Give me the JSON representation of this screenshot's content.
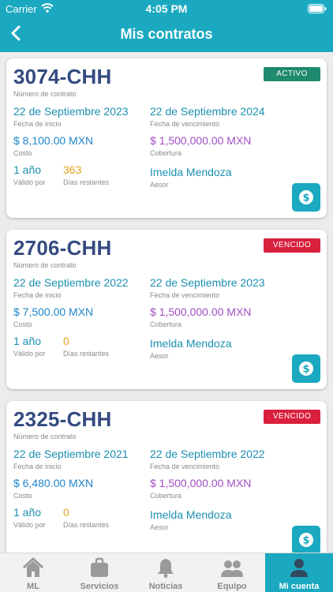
{
  "status_bar": {
    "carrier": "Carrier",
    "time": "4:05 PM"
  },
  "header": {
    "title": "Mis contratos"
  },
  "labels": {
    "contract_number": "Número de contrato",
    "start_date": "Fecha de inicio",
    "end_date": "Fecha de vencimiento",
    "cost": "Costo",
    "coverage": "Cobertura",
    "valid_for": "Válido por",
    "days_left": "Días restantes",
    "advisor": "Aesor"
  },
  "contracts": [
    {
      "number": "3074-CHH",
      "status": "ACTIVO",
      "start_date": "22 de Septiembre 2023",
      "end_date": "22 de Septiembre 2024",
      "cost": "$ 8,100.00 MXN",
      "coverage": "$ 1,500,000.00 MXN",
      "valid_for": "1 año",
      "days_left": "363",
      "advisor": "Imelda Mendoza"
    },
    {
      "number": "2706-CHH",
      "status": "VENCIDO",
      "start_date": "22 de Septiembre 2022",
      "end_date": "22 de Septiembre 2023",
      "cost": "$ 7,500.00 MXN",
      "coverage": "$ 1,500,000.00 MXN",
      "valid_for": "1 año",
      "days_left": "0",
      "advisor": "Imelda Mendoza"
    },
    {
      "number": "2325-CHH",
      "status": "VENCIDO",
      "start_date": "22 de Septiembre 2021",
      "end_date": "22 de Septiembre 2022",
      "cost": "$ 6,480.00 MXN",
      "coverage": "$ 1,500,000.00 MXN",
      "valid_for": "1 año",
      "days_left": "0",
      "advisor": "Imelda Mendoza"
    }
  ],
  "tabbar": {
    "items": [
      {
        "label": "ML",
        "icon": "home-icon"
      },
      {
        "label": "Servicios",
        "icon": "briefcase-icon"
      },
      {
        "label": "Noticias",
        "icon": "bell-icon"
      },
      {
        "label": "Equipo",
        "icon": "team-icon"
      },
      {
        "label": "Mi cuenta",
        "icon": "person-icon"
      }
    ],
    "active": "Mi cuenta"
  },
  "colors": {
    "primary": "#1aa9c0",
    "contract_number": "#344b80",
    "active_badge": "#1f8a6d",
    "expired_badge": "#d9203d",
    "date": "#1b8fb0",
    "cost": "#1f86c8",
    "coverage": "#a24fc4",
    "days_left": "#e9a019"
  }
}
